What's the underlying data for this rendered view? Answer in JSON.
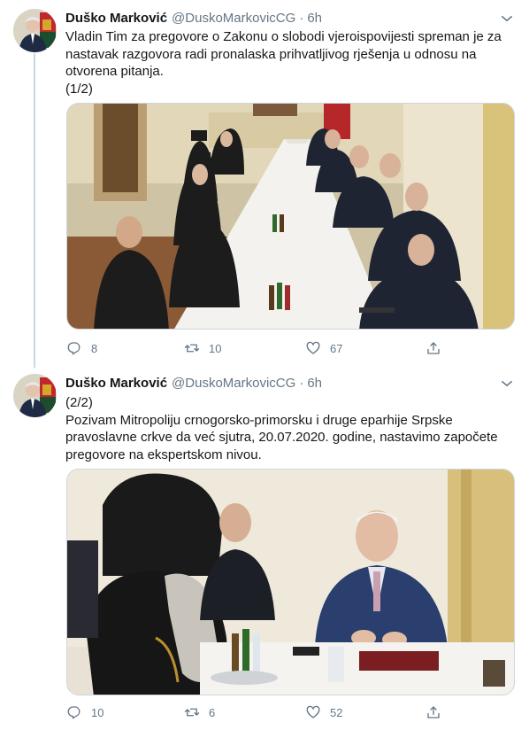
{
  "tweets": [
    {
      "author": {
        "name": "Duško Marković",
        "handle": "@DuskoMarkovicCG",
        "avatar": "avatar-photo"
      },
      "time": "6h",
      "text_lines": [
        "Vladin Tim za pregovore o Zakonu o slobodi vjeroispovijesti spreman je za",
        "nastavak razgovora radi pronalaska prihvatljivog rješenja u odnosu na",
        "otvorena pitanja.",
        "(1/2)"
      ],
      "media": {
        "kind": "photo",
        "icon": "photo-meeting-table"
      },
      "stats": {
        "replies": "8",
        "retweets": "10",
        "likes": "67"
      }
    },
    {
      "author": {
        "name": "Duško Marković",
        "handle": "@DuskoMarkovicCG",
        "avatar": "avatar-photo"
      },
      "time": "6h",
      "text_lines": [
        "(2/2)",
        "Pozivam Mitropoliju crnogorsko-primorsku i druge eparhije Srpske",
        "pravoslavne crkve da već sjutra, 20.07.2020. godine, nastavimo započete",
        "pregovore na ekspertskom nivou."
      ],
      "media": {
        "kind": "photo",
        "icon": "photo-meeting-closeup"
      },
      "stats": {
        "replies": "10",
        "retweets": "6",
        "likes": "52"
      }
    }
  ],
  "separator": "·",
  "icons": [
    "reply-icon",
    "retweet-icon",
    "like-icon",
    "share-icon",
    "chevron-down-icon"
  ],
  "colors": {
    "text": "#14171a",
    "secondary": "#657786",
    "border": "#ccd6dd"
  }
}
